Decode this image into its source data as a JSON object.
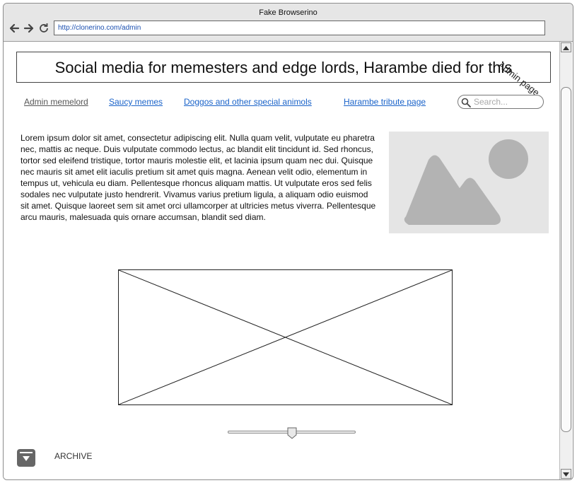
{
  "browser": {
    "title": "Fake Browserino",
    "url": "http://clonerino.com/admin"
  },
  "header": {
    "title": "Social media for memesters and edge lords, Harambe died for this",
    "corner_label": "Admin page"
  },
  "nav": {
    "links": [
      {
        "label": "Admin memelord"
      },
      {
        "label": "Saucy memes"
      },
      {
        "label": "Doggos and other special animols"
      },
      {
        "label": "Harambe tribute page"
      }
    ]
  },
  "search": {
    "placeholder": "Search..."
  },
  "body": {
    "text": "Lorem ipsum dolor sit amet, consectetur adipiscing elit. Nulla quam velit, vulputate eu pharetra nec, mattis ac neque. Duis vulputate commodo lectus, ac blandit elit tincidunt id. Sed rhoncus, tortor sed eleifend tristique, tortor mauris molestie elit, et lacinia ipsum quam nec dui. Quisque nec mauris sit amet elit iaculis pretium sit amet quis magna. Aenean velit odio, elementum in tempus ut, vehicula eu diam. Pellentesque rhoncus aliquam mattis. Ut vulputate eros sed felis sodales nec vulputate justo hendrerit. Vivamus varius pretium ligula, a aliquam odio euismod sit amet. Quisque laoreet sem sit amet orci ullamcorper at ultricies metus viverra. Pellentesque arcu mauris, malesuada quis ornare accumsan, blandit sed diam."
  },
  "slider": {
    "value": 0.5
  },
  "archive": {
    "label": "ARCHIVE"
  },
  "icons": {
    "back": "back-arrow-icon",
    "forward": "forward-arrow-icon",
    "reload": "reload-icon",
    "search": "search-icon",
    "image": "image-placeholder-icon",
    "archive": "download-icon"
  },
  "colors": {
    "link": "#1a63c9",
    "visited_link": "#555555",
    "url_text": "#1a4fb0",
    "image_placeholder_bg": "#e5e5e5",
    "image_shape": "#b3b3b3"
  }
}
